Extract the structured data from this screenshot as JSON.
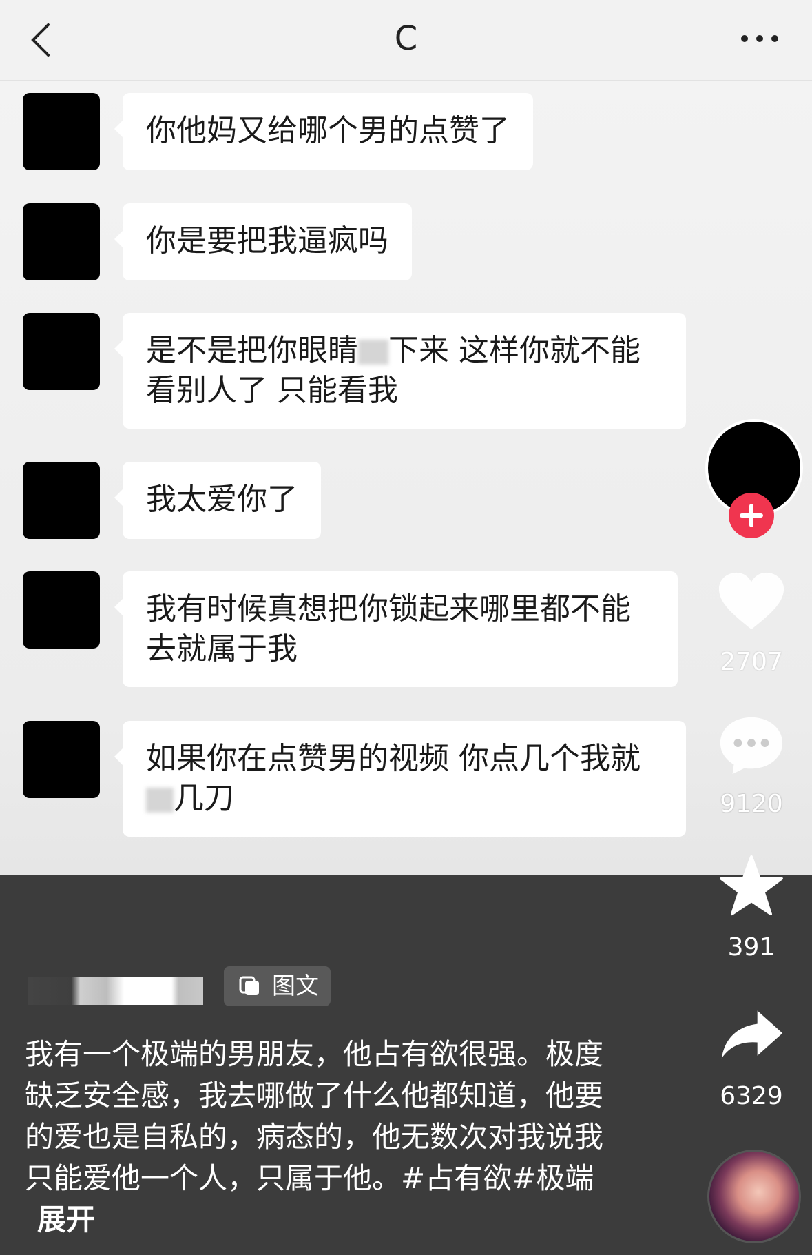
{
  "header": {
    "title": "C"
  },
  "messages": [
    {
      "text": "你他妈又给哪个男的点赞了"
    },
    {
      "text": "你是要把我逼疯吗"
    },
    {
      "text": "是不是把你眼睛",
      "text_after": "下来 这样你就不能看别人了 只能看我"
    },
    {
      "text": "我太爱你了"
    },
    {
      "text": "我有时候真想把你锁起来哪里都不能去就属于我"
    },
    {
      "text": "如果你在点赞男的视频 你点几个我就",
      "text_after": "几刀"
    }
  ],
  "actions": {
    "likes": "2707",
    "comments": "9120",
    "favorites": "391",
    "shares": "6329"
  },
  "post": {
    "tag_label": "图文",
    "description": "我有一个极端的男朋友，他占有欲很强。极度缺乏安全感，我去哪做了什么他都知道，他要的爱也是自私的，病态的，他无数次对我说我只能爱他一个人，只属于他。#占有欲#极端",
    "expand_label": "展开"
  },
  "colors": {
    "follow_red": "#f0354f",
    "panel_dark": "#3c3c3c"
  }
}
